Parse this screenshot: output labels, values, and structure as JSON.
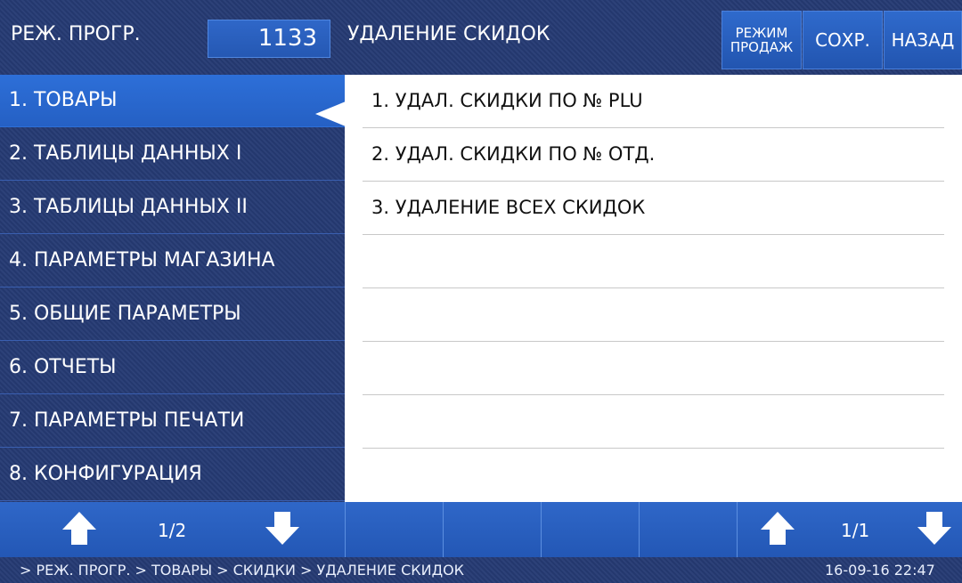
{
  "header": {
    "mode_label": "РЕЖ. ПРОГР.",
    "code": "1133",
    "title": "УДАЛЕНИЕ СКИДОК",
    "btn_mode_line1": "РЕЖИМ",
    "btn_mode_line2": "ПРОДАЖ",
    "btn_save": "СОХР.",
    "btn_back": "НАЗАД"
  },
  "sidebar": {
    "items": [
      {
        "label": "1. ТОВАРЫ"
      },
      {
        "label": "2. ТАБЛИЦЫ ДАННЫХ I"
      },
      {
        "label": "3. ТАБЛИЦЫ ДАННЫХ II"
      },
      {
        "label": "4. ПАРАМЕТРЫ МАГАЗИНА"
      },
      {
        "label": "5. ОБЩИЕ ПАРАМЕТРЫ"
      },
      {
        "label": "6. ОТЧЕТЫ"
      },
      {
        "label": "7. ПАРАМЕТРЫ ПЕЧАТИ"
      },
      {
        "label": "8. КОНФИГУРАЦИЯ"
      }
    ],
    "active_index": 0
  },
  "content": {
    "items": [
      {
        "label": "1. УДАЛ. СКИДКИ ПО № PLU"
      },
      {
        "label": "2. УДАЛ. СКИДКИ ПО № ОТД."
      },
      {
        "label": "3. УДАЛЕНИЕ ВСЕХ СКИДОК"
      },
      {
        "label": ""
      },
      {
        "label": ""
      },
      {
        "label": ""
      },
      {
        "label": ""
      },
      {
        "label": ""
      }
    ]
  },
  "footer": {
    "left_page": "1/2",
    "right_page": "1/1"
  },
  "status": {
    "path": "> РЕЖ. ПРОГР.  > ТОВАРЫ > СКИДКИ > УДАЛЕНИЕ СКИДОК",
    "datetime": "16-09-16  22:47"
  },
  "colors": {
    "accent": "#2d6fd8",
    "panel": "#253a73",
    "content_bg": "#ffffff"
  }
}
